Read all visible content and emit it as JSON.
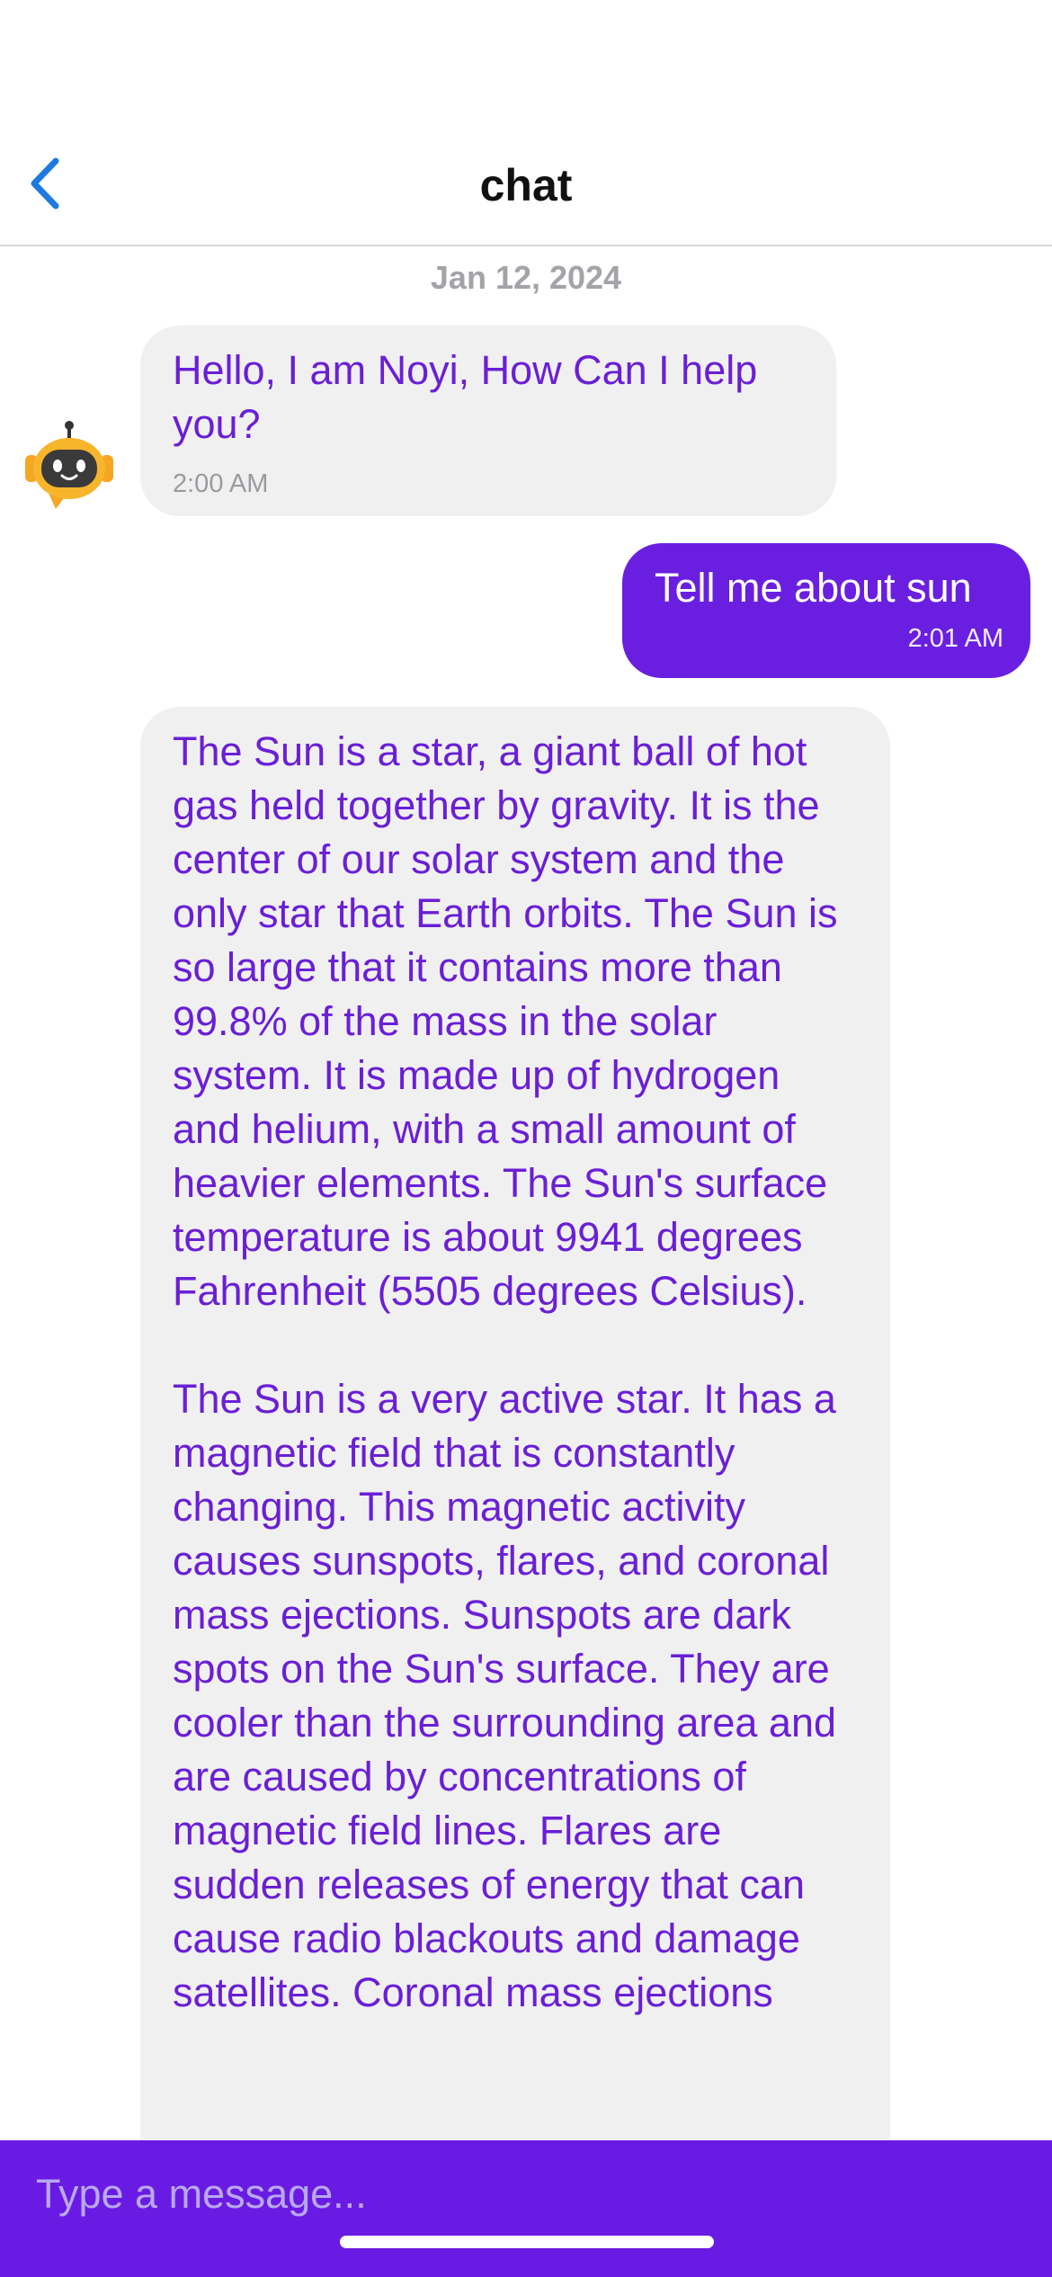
{
  "header": {
    "title": "chat",
    "back_icon": "chevron-left-icon",
    "accent_color": "#1f7ae0"
  },
  "chat": {
    "date_separator": "Jan 12, 2024",
    "messages": [
      {
        "sender": "bot",
        "text": "Hello, I am Noyi, How Can I help you?",
        "time": "2:00 AM"
      },
      {
        "sender": "user",
        "text": "Tell me about sun",
        "time": "2:01 AM"
      },
      {
        "sender": "bot",
        "text": "The Sun is a star, a giant ball of hot gas held together by gravity. It is the center of our solar system and the only star that Earth orbits. The Sun is so large that it contains more than 99.8% of the mass in the solar system. It is made up of hydrogen and helium, with a small amount of heavier elements. The Sun's surface temperature is about 9941 degrees Fahrenheit (5505 degrees Celsius).\n\nThe Sun is a very active star. It has a magnetic field that is constantly changing. This magnetic activity causes sunspots, flares, and coronal mass ejections. Sunspots are dark spots on the Sun's surface. They are cooler than the surrounding area and are caused by concentrations of magnetic field lines. Flares are sudden releases of energy that can cause radio blackouts and damage satellites. Coronal mass ejections"
      }
    ]
  },
  "input": {
    "placeholder": "Type a message..."
  },
  "colors": {
    "brand_purple": "#6a1be3",
    "bubble_gray": "#f0f0f0",
    "bot_text": "#6a1fd6"
  }
}
